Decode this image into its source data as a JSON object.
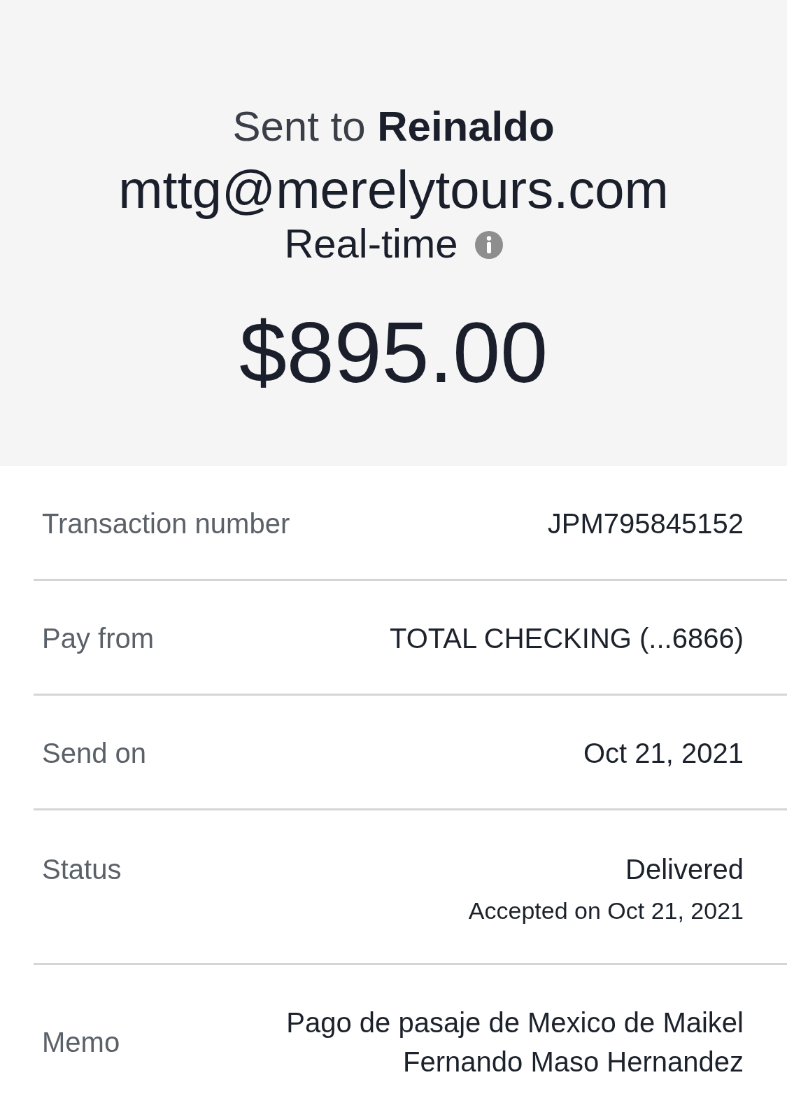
{
  "header": {
    "title": "Sent to **Reinaldo**",
    "email": "mttg@merelytours.com",
    "speed": "Real-time",
    "amount": "$895.00"
  },
  "details": [
    {
      "label": "Transaction number",
      "value": "JPM795845152"
    },
    {
      "label": "Pay from",
      "value": "TOTAL CHECKING (...6866)"
    },
    {
      "label": "Send on",
      "value": "Oct 21, 2021"
    },
    {
      "label": "Status",
      "value": "Delivered",
      "note": "Accepted on Oct 21, 2021"
    },
    {
      "label": "Memo",
      "value": "Pago de pasaje de Mexico de Maikel Fernando Maso Hernandez"
    }
  ]
}
